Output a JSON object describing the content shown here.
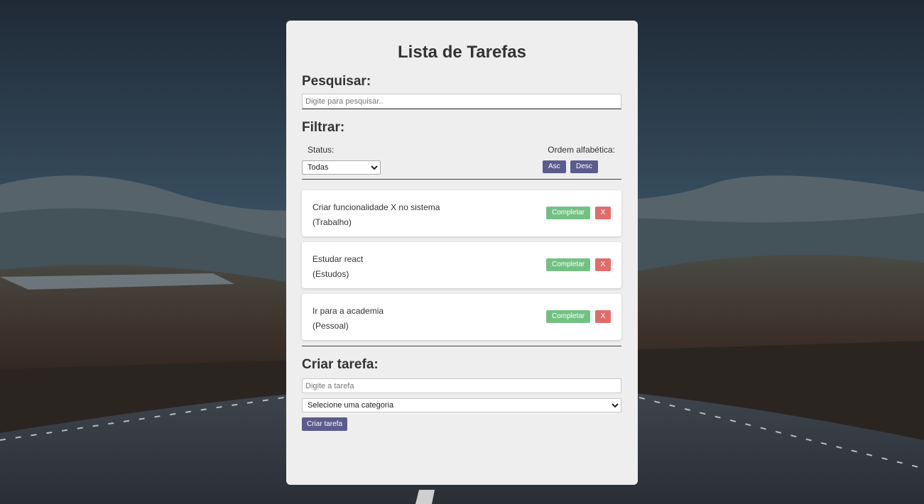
{
  "app": {
    "title": "Lista de Tarefas"
  },
  "search": {
    "heading": "Pesquisar:",
    "placeholder": "Digite para pesquisar.."
  },
  "filter": {
    "heading": "Filtrar:",
    "status_label": "Status:",
    "status_selected": "Todas",
    "order_label": "Ordem alfabética:",
    "asc_label": "Asc",
    "desc_label": "Desc"
  },
  "todos": [
    {
      "text": "Criar funcionalidade X no sistema",
      "category": "(Trabalho)",
      "complete_label": "Completar",
      "delete_label": "X"
    },
    {
      "text": "Estudar react",
      "category": "(Estudos)",
      "complete_label": "Completar",
      "delete_label": "X"
    },
    {
      "text": "Ir para a academia",
      "category": "(Pessoal)",
      "complete_label": "Completar",
      "delete_label": "X"
    }
  ],
  "create": {
    "heading": "Criar tarefa:",
    "input_placeholder": "Digite a tarefa",
    "category_selected": "Selecione uma categoria",
    "button_label": "Criar tarefa"
  },
  "colors": {
    "primary": "#5c5b8d",
    "complete": "#72c183",
    "delete": "#e06c6c",
    "panel": "#eeeeee"
  }
}
